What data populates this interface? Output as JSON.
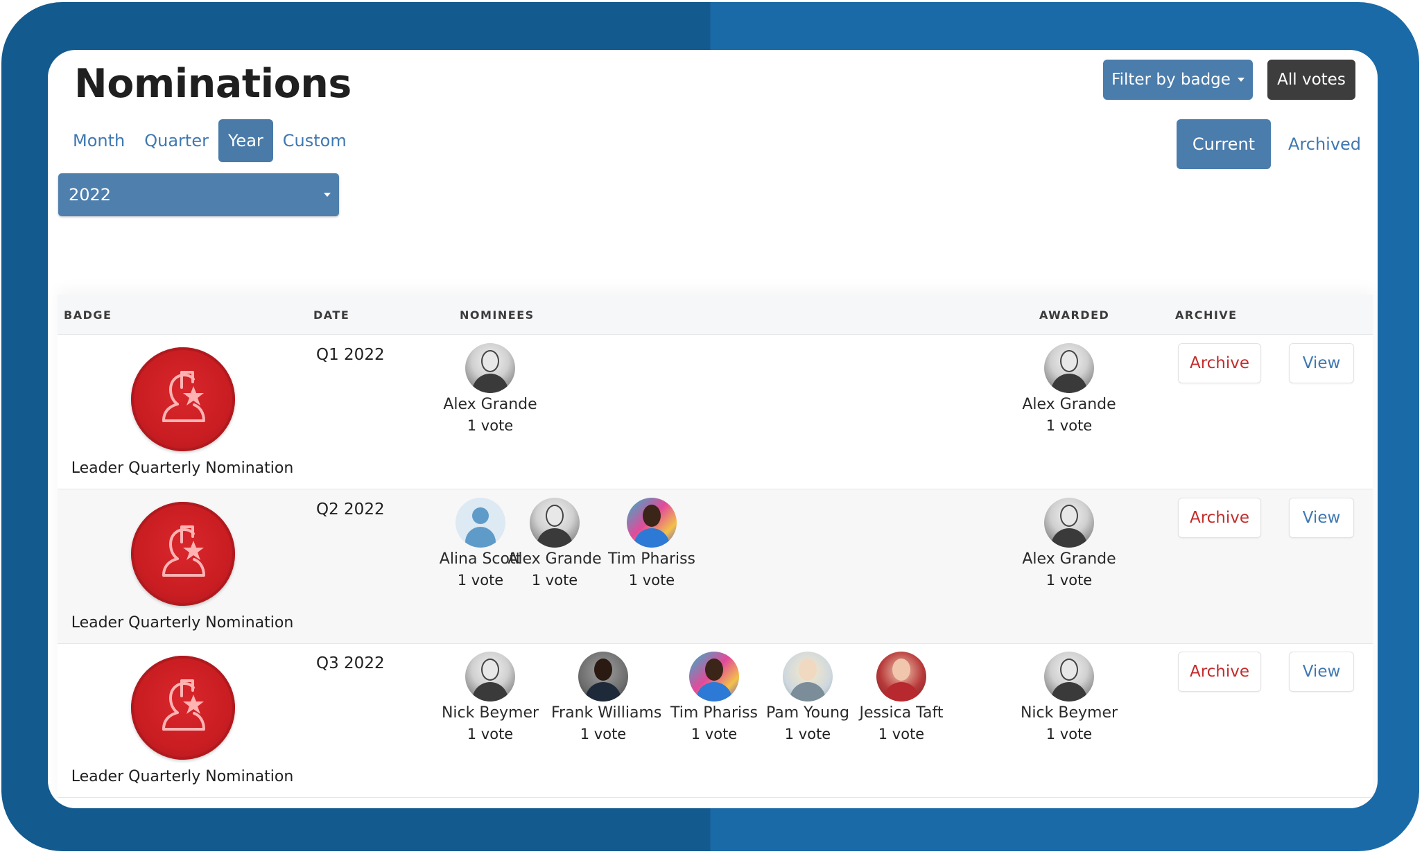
{
  "header": {
    "title": "Nominations",
    "filter_button": "Filter by badge",
    "all_votes_button": "All votes"
  },
  "period_tabs": [
    {
      "label": "Month",
      "active": false
    },
    {
      "label": "Quarter",
      "active": false
    },
    {
      "label": "Year",
      "active": true
    },
    {
      "label": "Custom",
      "active": false
    }
  ],
  "year_select": {
    "value": "2022"
  },
  "status_tabs": [
    {
      "label": "Current",
      "active": true
    },
    {
      "label": "Archived",
      "active": false
    }
  ],
  "table": {
    "headers": {
      "badge": "BADGE",
      "date": "DATE",
      "nominees": "NOMINEES",
      "awarded": "AWARDED",
      "archive": "ARCHIVE"
    },
    "archive_label": "Archive",
    "view_label": "View",
    "rows": [
      {
        "badge": "Leader Quarterly Nomination",
        "date": "Q1 2022",
        "nominees": [
          {
            "name": "Alex Grande",
            "votes": "1 vote",
            "avatar": "bw"
          }
        ],
        "awarded": {
          "name": "Alex Grande",
          "votes": "1 vote",
          "avatar": "bw"
        }
      },
      {
        "badge": "Leader Quarterly Nomination",
        "date": "Q2 2022",
        "nominees": [
          {
            "name": "Alina Scott",
            "votes": "1 vote",
            "avatar": "default"
          },
          {
            "name": "Alex Grande",
            "votes": "1 vote",
            "avatar": "bw"
          },
          {
            "name": "Tim Phariss",
            "votes": "1 vote",
            "avatar": "colorful"
          }
        ],
        "awarded": {
          "name": "Alex Grande",
          "votes": "1 vote",
          "avatar": "bw"
        }
      },
      {
        "badge": "Leader Quarterly Nomination",
        "date": "Q3 2022",
        "nominees": [
          {
            "name": "Nick Beymer",
            "votes": "1 vote",
            "avatar": "bw"
          },
          {
            "name": "Frank Williams",
            "votes": "1 vote",
            "avatar": "dark"
          },
          {
            "name": "Tim Phariss",
            "votes": "1 vote",
            "avatar": "colorful"
          },
          {
            "name": "Pam Young",
            "votes": "1 vote",
            "avatar": "light"
          },
          {
            "name": "Jessica Taft",
            "votes": "1 vote",
            "avatar": "red"
          }
        ],
        "awarded": {
          "name": "Nick Beymer",
          "votes": "1 vote",
          "avatar": "bw"
        }
      }
    ]
  },
  "colors": {
    "frame_dark": "#135a8e",
    "frame_light": "#1a6aa8",
    "accent": "#4a7cac",
    "link": "#3f78b2",
    "archive_text": "#c42b2b",
    "badge_red": "#c91d22"
  }
}
